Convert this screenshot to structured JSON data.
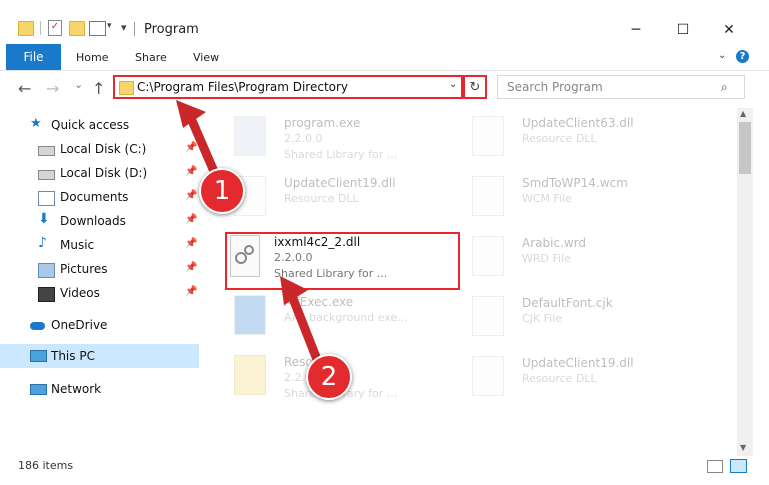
{
  "window": {
    "title": "Program",
    "minimize_glyph": "─",
    "maximize_glyph": "☐",
    "close_glyph": "✕"
  },
  "ribbon": {
    "tabs": [
      "File",
      "Home",
      "Share",
      "View"
    ],
    "help_glyph": "?"
  },
  "nav": {
    "back_glyph": "←",
    "forward_glyph": "→",
    "recent_glyph": "⌄",
    "up_glyph": "↑",
    "address": "C:\\Program Files\\Program Directory",
    "refresh_glyph": "↻",
    "search_placeholder": "Search Program"
  },
  "sidebar": {
    "items": [
      {
        "label": "Quick access",
        "icon": "star-icon"
      },
      {
        "label": "Local Disk (C:)",
        "icon": "drive-icon",
        "pinned": true
      },
      {
        "label": "Local Disk (D:)",
        "icon": "drive-icon",
        "pinned": true
      },
      {
        "label": "Documents",
        "icon": "documents-icon",
        "pinned": true
      },
      {
        "label": "Downloads",
        "icon": "downloads-icon",
        "pinned": true
      },
      {
        "label": "Music",
        "icon": "music-icon",
        "pinned": true
      },
      {
        "label": "Pictures",
        "icon": "pictures-icon",
        "pinned": true
      },
      {
        "label": "Videos",
        "icon": "videos-icon",
        "pinned": true
      },
      {
        "label": "OneDrive",
        "icon": "cloud-icon"
      },
      {
        "label": "This PC",
        "icon": "computer-icon",
        "selected": true
      },
      {
        "label": "Network",
        "icon": "network-icon"
      }
    ]
  },
  "files": {
    "col1": [
      {
        "name": "program.exe",
        "type": "2.2.0.0",
        "sub": "Shared Library for ..."
      },
      {
        "name": "UpdateClient19.dll",
        "type": "Resource DLL",
        "sub": ""
      },
      {
        "name": "ixxml4c2_2.dll",
        "type": "2.2.0.0",
        "sub": "Shared Library for ..."
      },
      {
        "name": "AlfExec.exe",
        "type": "AAF background exe...",
        "sub": ""
      },
      {
        "name": "Resources",
        "type": "2.2.0.0",
        "sub": "Shared Library for ..."
      }
    ],
    "col2": [
      {
        "name": "UpdateClient63.dll",
        "type": "Resource DLL"
      },
      {
        "name": "SmdToWP14.wcm",
        "type": "WCM File"
      },
      {
        "name": "Arabic.wrd",
        "type": "WRD File"
      },
      {
        "name": "DefaultFont.cjk",
        "type": "CJK File"
      },
      {
        "name": "UpdateClient19.dll",
        "type": "Resource DLL"
      }
    ]
  },
  "status": {
    "count": "186 items"
  },
  "annotations": {
    "step1": "1",
    "step2": "2"
  },
  "colors": {
    "accent": "#1979ca",
    "highlight": "#e8262c",
    "selected": "#cce8ff"
  }
}
